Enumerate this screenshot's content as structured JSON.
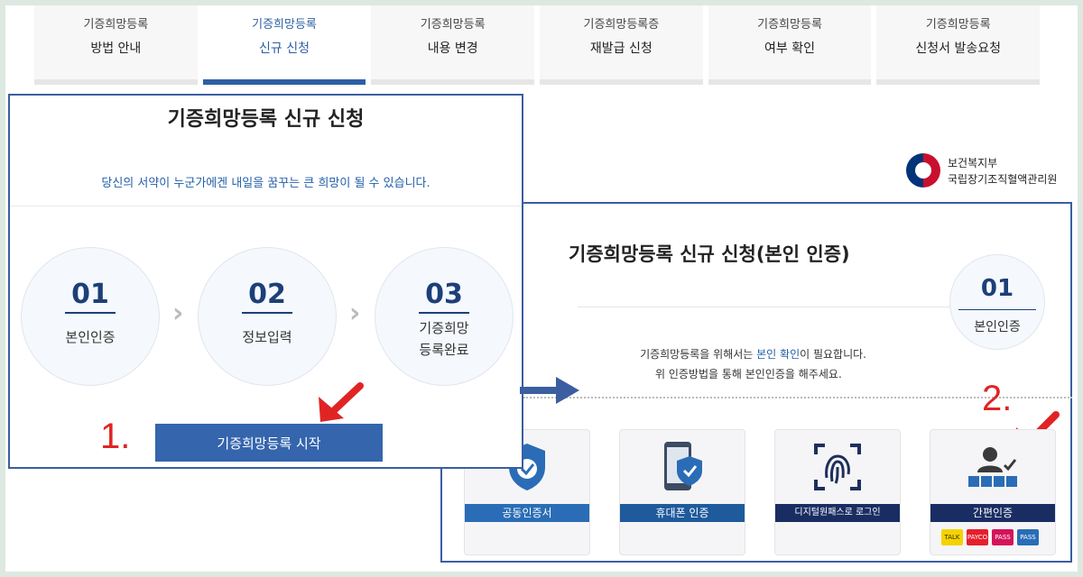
{
  "tabs": [
    {
      "line1": "기증희망등록",
      "line2": "방법 안내",
      "active": false
    },
    {
      "line1": "기증희망등록",
      "line2": "신규 신청",
      "active": true
    },
    {
      "line1": "기증희망등록",
      "line2": "내용 변경",
      "active": false
    },
    {
      "line1": "기증희망등록증",
      "line2": "재발급 신청",
      "active": false
    },
    {
      "line1": "기증희망등록",
      "line2": "여부 확인",
      "active": false
    },
    {
      "line1": "기증희망등록",
      "line2": "신청서 발송요청",
      "active": false
    }
  ],
  "left": {
    "title": "기증희망등록 신규 신청",
    "subtitle": "당신의 서약이 누군가에겐 내일을 꿈꾸는 큰 희망이 될 수 있습니다.",
    "steps": [
      {
        "num": "01",
        "label": "본인인증"
      },
      {
        "num": "02",
        "label": "정보입력"
      },
      {
        "num": "03",
        "label": "기증희망",
        "label2": "등록완료"
      }
    ],
    "start_button": "기증희망등록 시작",
    "marker": "1."
  },
  "ministry": {
    "line1": "보건복지부",
    "line2": "국립장기조직혈액관리원"
  },
  "right": {
    "title": "기증희망등록 신규 신청(본인 인증)",
    "step": {
      "num": "01",
      "label": "본인인증"
    },
    "desc_pre": "기증희망등록을 위해서는 ",
    "desc_hl": "본인 확인",
    "desc_post": "이 필요합니다.",
    "desc2": "위 인증방법을 통해 본인인증을 해주세요.",
    "marker": "2.",
    "methods": [
      {
        "label": "공동인증서"
      },
      {
        "label": "휴대폰 인증"
      },
      {
        "label": "디지털원패스로 로그인"
      },
      {
        "label": "간편인증"
      }
    ],
    "simple_brands": [
      "TALK",
      "PAYCO",
      "PASS",
      "PASS"
    ]
  },
  "colors": {
    "primary": "#3465ad",
    "accent_text": "#2360a8",
    "navy": "#1c3f78",
    "annotation": "#e02424",
    "frame": "#3b5ea0"
  }
}
